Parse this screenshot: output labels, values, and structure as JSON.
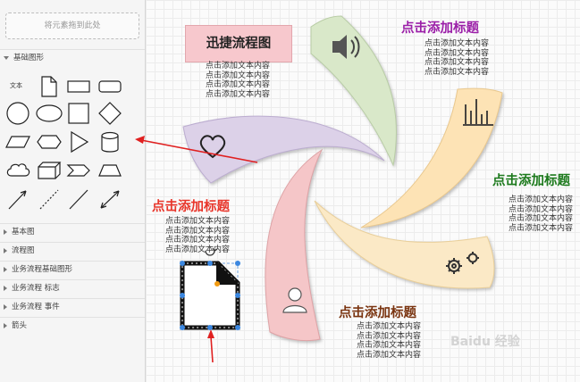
{
  "panel": {
    "dropzone": "将元素拖到此处",
    "basic_header": "基础图形",
    "shape_text_label": "文本",
    "categories": [
      "基本图",
      "流程图",
      "业务流程基础图形",
      "业务流程 标志",
      "业务流程 事件",
      "箭头"
    ]
  },
  "canvas": {
    "main_title": "迅捷流程图",
    "titles": [
      "点击添加标题",
      "点击添加标题",
      "点击添加标题",
      "点击添加标题"
    ],
    "title_colors": [
      "#9b1fa8",
      "#1d7a1d",
      "#7a3410",
      "#e8352a"
    ],
    "body_lines": "点击添加文本内容\n点击添加文本内容\n点击添加文本内容\n点击添加文本内容",
    "petal_colors": [
      "#d9e8c9",
      "#fde3b5",
      "#fbe9c6",
      "#f5c6c8",
      "#dcd1e8"
    ]
  },
  "watermark": "Baidu 经验"
}
